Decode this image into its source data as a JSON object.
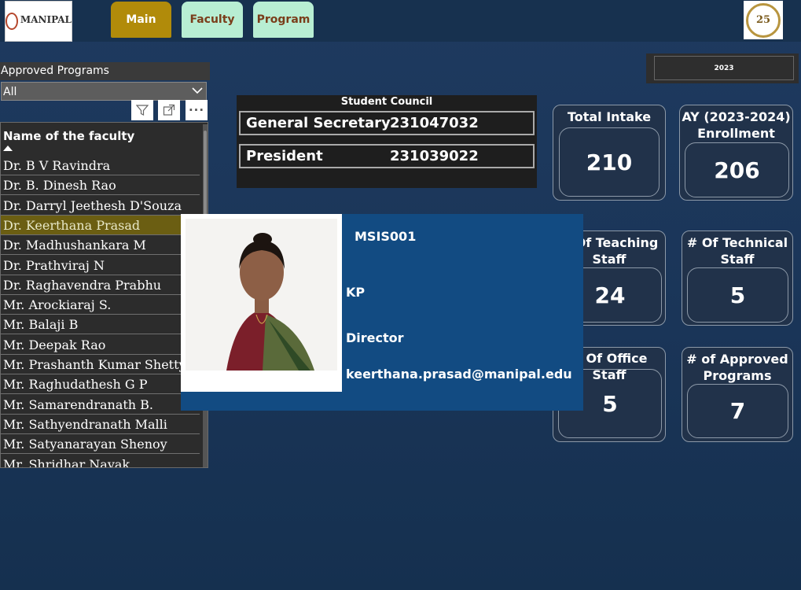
{
  "header": {
    "left_logo_text": "MANIPAL",
    "right_logo_text": "25",
    "nav": {
      "main": "Main",
      "faculty": "Faculty",
      "program": "Program"
    }
  },
  "slicer": {
    "label": "Approved Programs",
    "selected": "All"
  },
  "faculty_list": {
    "header": "Name of the faculty",
    "items": [
      "Dr. B V Ravindra",
      "Dr. B. Dinesh Rao",
      "Dr. Darryl Jeethesh D'Souza",
      "Dr. Keerthana Prasad",
      "Dr. Madhushankara M",
      "Dr. Prathviraj N",
      "Dr. Raghavendra Prabhu",
      "Mr. Arockiaraj S.",
      "Mr. Balaji B",
      "Mr. Deepak Rao",
      "Mr. Prashanth Kumar Shetty",
      "Mr. Raghudathesh G P",
      "Mr. Samarendranath B.",
      "Mr. Sathyendranath Malli",
      "Mr. Satyanarayan Shenoy",
      "Mr. Shridhar Nayak"
    ],
    "selected_index": 3
  },
  "student_council": {
    "title": "Student Council",
    "rows": [
      {
        "role": "General Secretary",
        "id": "231047032"
      },
      {
        "role": "President",
        "id": "231039022"
      }
    ]
  },
  "year_filter": "2023",
  "kpis": {
    "total_intake": {
      "title": "Total Intake",
      "value": "210"
    },
    "enrollment": {
      "title_line1": "AY (2023-2024)",
      "title_line2": "Enrollment",
      "value": "206"
    },
    "teaching": {
      "title_line1": "# Of Teaching",
      "title_line2": "Staff",
      "value": "24"
    },
    "technical": {
      "title_line1": "# Of Technical",
      "title_line2": "Staff",
      "value": "5"
    },
    "office": {
      "title": "# Of Office Staff",
      "value": "5"
    },
    "programs": {
      "title_line1": "# of Approved",
      "title_line2": "Programs",
      "value": "7"
    }
  },
  "tooltip": {
    "code": "MSIS001",
    "initials": "KP",
    "designation": "Director",
    "email": "keerthana.prasad@manipal.edu"
  },
  "colors": {
    "background": "#1b3658",
    "nav_main": "#b18b0a",
    "nav_tab": "#b8eed3",
    "selected_row": "#6b5e12",
    "tooltip_bg": "#124b82"
  }
}
